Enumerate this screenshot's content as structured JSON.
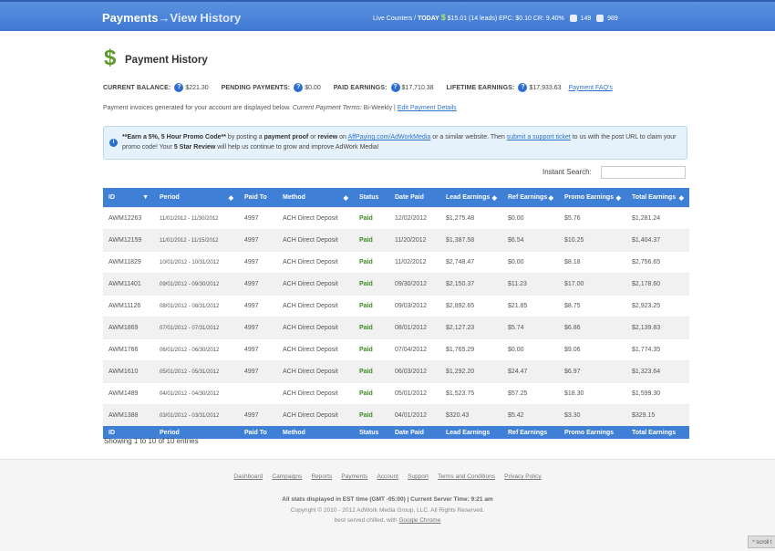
{
  "header": {
    "crumb_main": "Payments",
    "crumb_sub": "→View History",
    "live_counters_label": "Live Counters /",
    "today_label": "TODAY",
    "today_stats": "$15.01 (14 leads)  EPC: $0.10  CR: 9.40%",
    "count_one": "149",
    "count_two": "989"
  },
  "page": {
    "title": "Payment History",
    "current_balance_label": "CURRENT BALANCE:",
    "current_balance": "$221.30",
    "pending_label": "PENDING PAYMENTS:",
    "pending": "$0.00",
    "paid_label": "PAID EARNINGS:",
    "paid": "$17,710.38",
    "lifetime_label": "LIFETIME EARNINGS:",
    "lifetime": "$17,933.63",
    "faq_link": "Payment FAQ's",
    "invoice_text": "Payment invoices generated for your account are displayed below. ",
    "terms_label": "Current Payment Terms: ",
    "terms_value": "Bi-Weekly | ",
    "edit_link": "Edit Payment Details"
  },
  "promo": {
    "p1": "**Earn a 5%, 5 Hour Promo Code**",
    "p2": " by posting a ",
    "p3": "payment proof",
    "p4": " or ",
    "p5": "review",
    "p6": " on ",
    "link1": "AffPaying.com/AdWorkMedia",
    "p7": " or a similar website. Then ",
    "link2": "submit a support ticket",
    "p8": " to us with the post URL to claim your promo code! Your ",
    "p9": "5 Star Review",
    "p10": " will help us continue to grow and improve AdWork Media!"
  },
  "search": {
    "label": "Instant Search:"
  },
  "table": {
    "columns": [
      "ID",
      "Period",
      "Paid To",
      "Method",
      "Status",
      "Date Paid",
      "Lead Earnings",
      "Ref Earnings",
      "Promo Earnings",
      "Total Earnings"
    ],
    "rows": [
      [
        "AWM12263",
        "11/01/2012 - 11/30/2012",
        "4997",
        "ACH Direct Deposit",
        "Paid",
        "12/02/2012",
        "$1,275.48",
        "$0.00",
        "$5.76",
        "$1,281.24"
      ],
      [
        "AWM12159",
        "11/01/2012 - 11/15/2012",
        "4997",
        "ACH Direct Deposit",
        "Paid",
        "11/20/2012",
        "$1,387.58",
        "$6.54",
        "$10.25",
        "$1,404.37"
      ],
      [
        "AWM11829",
        "10/01/2012 - 10/31/2012",
        "4997",
        "ACH Direct Deposit",
        "Paid",
        "11/02/2012",
        "$2,748.47",
        "$0.00",
        "$8.18",
        "$2,756.65"
      ],
      [
        "AWM11401",
        "09/01/2012 - 09/30/2012",
        "4997",
        "ACH Direct Deposit",
        "Paid",
        "09/30/2012",
        "$2,150.37",
        "$11.23",
        "$17.00",
        "$2,178.60"
      ],
      [
        "AWM11126",
        "08/01/2012 - 08/31/2012",
        "4997",
        "ACH Direct Deposit",
        "Paid",
        "09/03/2012",
        "$2,892.65",
        "$21.85",
        "$8.75",
        "$2,923.25"
      ],
      [
        "AWM1869",
        "07/01/2012 - 07/31/2012",
        "4997",
        "ACH Direct Deposit",
        "Paid",
        "08/01/2012",
        "$2,127.23",
        "$5.74",
        "$6.86",
        "$2,139.83"
      ],
      [
        "AWM1766",
        "06/01/2012 - 06/30/2012",
        "4997",
        "ACH Direct Deposit",
        "Paid",
        "07/04/2012",
        "$1,765.29",
        "$0.00",
        "$9.06",
        "$1,774.35"
      ],
      [
        "AWM1610",
        "05/01/2012 - 05/31/2012",
        "4997",
        "ACH Direct Deposit",
        "Paid",
        "06/03/2012",
        "$1,292.20",
        "$24.47",
        "$6.97",
        "$1,323.64"
      ],
      [
        "AWM1489",
        "04/01/2012 - 04/30/2012",
        "",
        "ACH Direct Deposit",
        "Paid",
        "05/01/2012",
        "$1,523.75",
        "$57.25",
        "$18.30",
        "$1,599.30"
      ],
      [
        "AWM1388",
        "03/01/2012 - 03/31/2012",
        "4997",
        "ACH Direct Deposit",
        "Paid",
        "04/01/2012",
        "$320.43",
        "$5.42",
        "$3.30",
        "$329.15"
      ]
    ],
    "showing": "Showing 1 to 10 of 10 entries"
  },
  "footer": {
    "links": [
      "Dashboard",
      "Campaigns",
      "Reports",
      "Payments",
      "Account",
      "Support",
      "Terms and Conditions",
      "Privacy Policy"
    ],
    "line1": "All stats displayed in EST time (GMT -05:00) | Current Server Time: 9:21 am",
    "line2": "Copyright © 2010 - 2012 AdWork Media Group, LLC. All Rights Reserved.",
    "line3": "best served chilled, with ",
    "line3_link": "Google Chrome",
    "scroll_tag": "* scroll t"
  }
}
